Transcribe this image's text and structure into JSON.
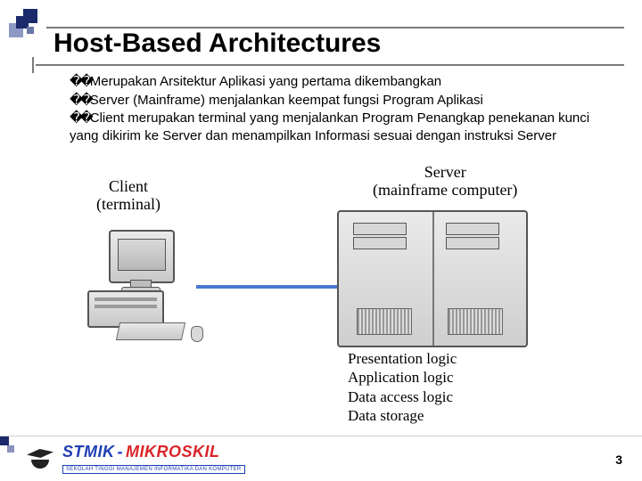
{
  "title": "Host-Based Architectures",
  "bullets": [
    "Merupakan Arsitektur  Aplikasi yang pertama dikembangkan",
    "Server (Mainframe) menjalankan keempat fungsi Program  Aplikasi",
    "Client merupakan terminal yang menjalankan Program Penangkap penekanan kunci yang dikirim ke Server dan menampilkan Informasi sesuai dengan instruksi Server"
  ],
  "diagram": {
    "client_label_line1": "Client",
    "client_label_line2": "(terminal)",
    "server_label_line1": "Server",
    "server_label_line2": "(mainframe computer)",
    "logic_list": [
      "Presentation logic",
      "Application logic",
      "Data access logic",
      "Data storage"
    ]
  },
  "footer": {
    "brand_stmik": "STMIK",
    "brand_dash": "-",
    "brand_mikro": "MIKROSKIL",
    "brand_sub": "SEKOLAH TINGGI MANAJEMEN INFORMATIKA DAN KOMPUTER"
  },
  "page_number": "3"
}
